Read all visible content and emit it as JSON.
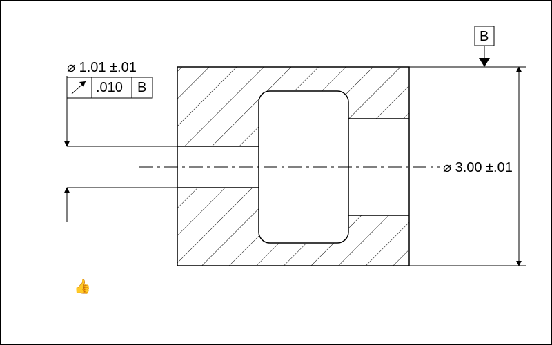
{
  "dimensions": {
    "bore": "⌀ 1.01 ±.01",
    "outer": "⌀ 3.00 ±.01"
  },
  "fcf": {
    "tolerance": ".010",
    "datum": "B"
  },
  "datum_label": "B",
  "verdict_icon": "thumbs-up"
}
